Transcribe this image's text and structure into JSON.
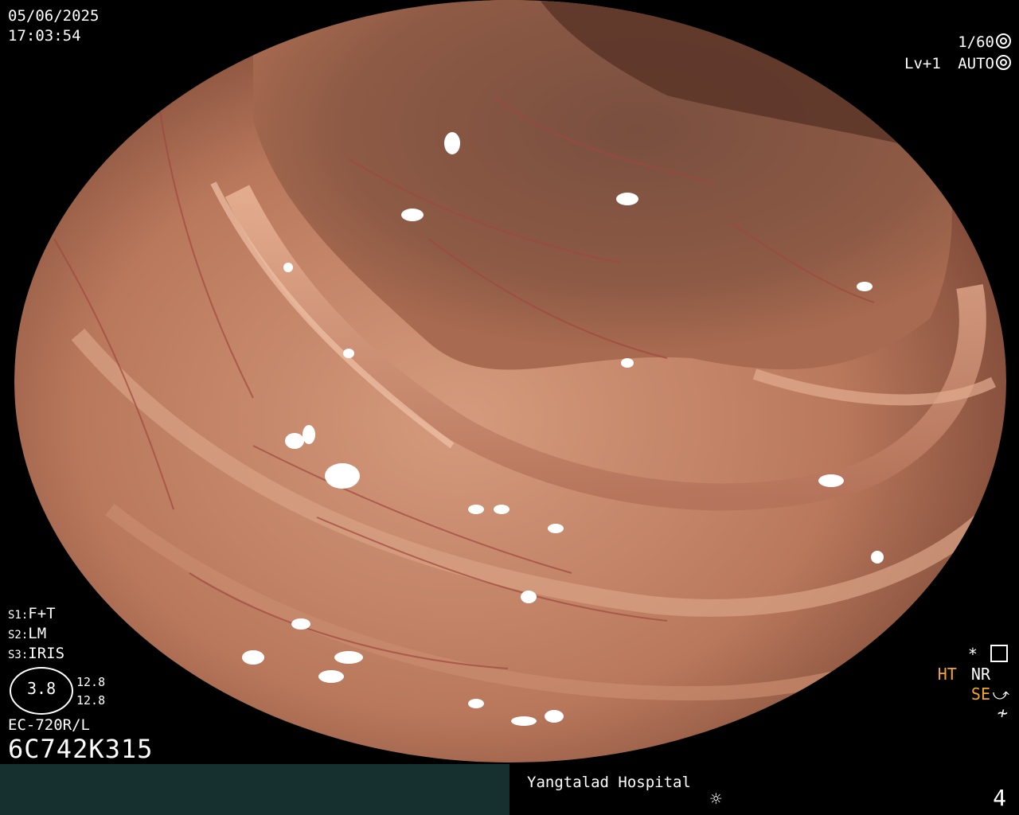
{
  "header": {
    "date": "05/06/2025",
    "time": "17:03:54",
    "shutter": "1/60",
    "shutter_icon": "aperture-icon",
    "level": "Lv+1",
    "mode": "AUTO",
    "mode_icon": "auto-exposure-icon"
  },
  "settings": {
    "s1_key": "S1:",
    "s1_val": "F+T",
    "s2_key": "S2:",
    "s2_val": "LM",
    "s3_key": "S3:",
    "s3_val": "IRIS"
  },
  "zoom": {
    "value": "3.8",
    "upper": "12.8",
    "lower": "12.8"
  },
  "scope": {
    "model": "EC-720R/L",
    "serial": "6C742K315"
  },
  "right_indicators": {
    "star": "*",
    "ht": "HT",
    "nr": "NR",
    "se": "SE",
    "se_icon": "curve-icon",
    "neq": "≁"
  },
  "footer": {
    "hospital": "Yangtalad Hospital",
    "sun_icon": "brightness-icon",
    "page": "4"
  },
  "colors": {
    "mucosa": "#c98b6e",
    "shadow": "#6b3d2c",
    "highlight_orange": "#f5a623",
    "bar": "#16302f"
  }
}
